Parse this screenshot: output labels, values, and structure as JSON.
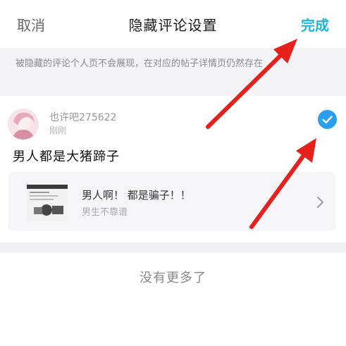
{
  "nav": {
    "cancel_label": "取消",
    "title": "隐藏评论设置",
    "done_label": "完成"
  },
  "notice": {
    "text": "被隐藏的评论个人页不会展现，在对应的帖子详情页仍然存在"
  },
  "comment": {
    "username": "也许吧275622",
    "time": "刚刚",
    "text": "男人都是大猪蹄子",
    "selected": true,
    "post": {
      "title": "男人啊！ 都是骗子！！",
      "subtitle": "男生不靠谱"
    }
  },
  "footer": {
    "no_more_text": "没有更多了"
  },
  "colors": {
    "accent": "#1fb5d6",
    "check": "#2a9ff0",
    "arrow": "#e8201c"
  },
  "icons": [
    "checkmark-icon",
    "chevron-right-icon",
    "avatar",
    "post-thumbnail"
  ]
}
